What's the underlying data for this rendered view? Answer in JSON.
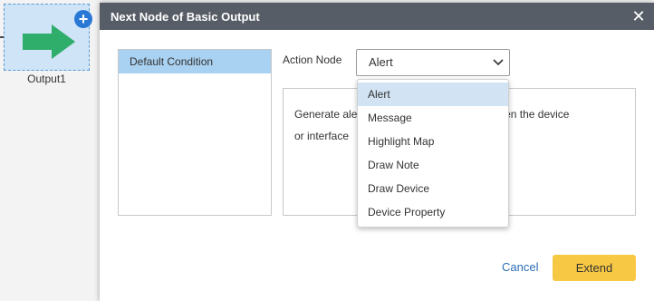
{
  "canvas": {
    "node": {
      "label": "Output1",
      "add_icon": "plus-circle-icon",
      "arrow_icon": "right-arrow-icon",
      "arrow_color": "#2fae6b"
    }
  },
  "dialog": {
    "title": "Next Node of Basic Output",
    "close_icon": "close-icon",
    "conditions": [
      "Default Condition"
    ],
    "action_label": "Action Node",
    "selected_action": "Alert",
    "description_line1": "Generate ale",
    "description_line1_end": "ace when the device",
    "description_line2": "or interface",
    "dropdown_options": [
      "Alert",
      "Message",
      "Highlight Map",
      "Draw Note",
      "Draw Device",
      "Device Property"
    ],
    "cancel_label": "Cancel",
    "extend_label": "Extend",
    "colors": {
      "header": "#575d66",
      "selected_condition": "#a9d1f1",
      "extend_button": "#f7c843",
      "link": "#2c6db5"
    }
  }
}
